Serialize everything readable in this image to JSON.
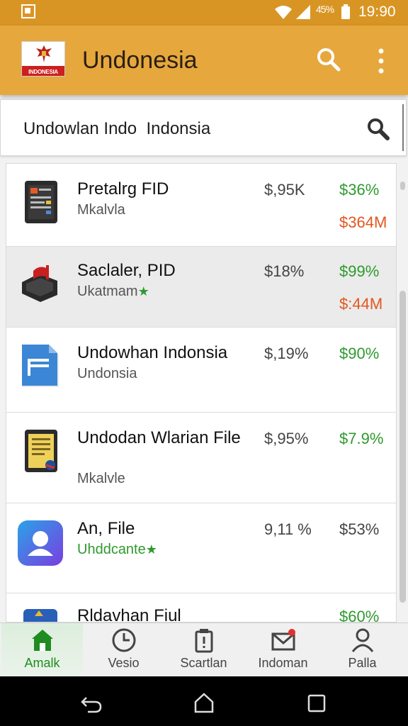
{
  "status_bar": {
    "battery_percent": "45%",
    "time": "19:90"
  },
  "app_bar": {
    "flag_text": "INDONESIA",
    "title": "Undonesia",
    "search_icon": "search-icon",
    "more_icon": "more-vert-icon"
  },
  "search": {
    "value": "Undowlan Indo  Indonsia",
    "icon": "search-icon"
  },
  "list": {
    "items": [
      {
        "name": "Pretalrg FID",
        "sub": "Mkalvla",
        "star": "",
        "value1": "$,95K",
        "value2": "$36%",
        "value3": "$364M",
        "icon": "tablet-app-icon",
        "selected": false
      },
      {
        "name": "Saclaler, PID",
        "sub": "Ukatmam",
        "star": "★",
        "value1": "$18%",
        "value2": "$99%",
        "value3": "$:44M",
        "icon": "mailbox-icon",
        "selected": true
      },
      {
        "name": "Undowhan Indonsia",
        "sub": "Undonsia",
        "star": "",
        "value1": "$,19%",
        "value2": "$90%",
        "value3": "",
        "icon": "document-icon",
        "selected": false
      },
      {
        "name": "Undodan Wlarian File",
        "sub": "Mkalvle",
        "star": "",
        "value1": "$,95%",
        "value2": "$7.9%",
        "value3": "",
        "icon": "file-viewer-icon",
        "selected": false
      },
      {
        "name": "An, File",
        "sub": "Uhddcante",
        "star": "★",
        "value1": "9,11 %",
        "value2": "$53%",
        "value3": "",
        "icon": "contact-app-icon",
        "selected": false
      },
      {
        "name": "Rldavhan Fiul",
        "sub": "",
        "star": "",
        "value1": "",
        "value2": "$60%",
        "value3": "",
        "icon": "app-icon",
        "selected": false
      }
    ]
  },
  "bottom_nav": {
    "items": [
      {
        "label": "Amalk",
        "icon": "home-icon",
        "active": true
      },
      {
        "label": "Vesio",
        "icon": "clock-icon",
        "active": false
      },
      {
        "label": "Scartlan",
        "icon": "alert-clipboard-icon",
        "active": false
      },
      {
        "label": "Indoman",
        "icon": "mail-icon",
        "active": false
      },
      {
        "label": "Palla",
        "icon": "person-icon",
        "active": false
      }
    ]
  },
  "colors": {
    "app_bar": "#e6a73d",
    "status_bar": "#d99524",
    "positive": "#2e9a2e",
    "highlight": "#e2571e"
  }
}
